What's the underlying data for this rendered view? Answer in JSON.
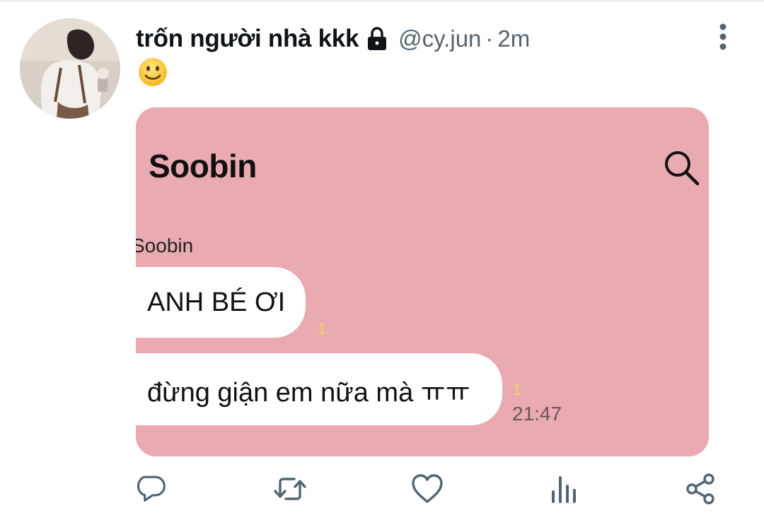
{
  "tweet": {
    "display_name": "trốn người nhà kkk",
    "handle": "@cy.jun",
    "separator": "·",
    "time": "2m",
    "emoji": "🙂"
  },
  "media": {
    "chat_title": "Soobin",
    "sender_name": "Soobin",
    "messages": [
      {
        "text": "ANH BÉ ƠI",
        "unread": "1"
      },
      {
        "text": "đừng giận em nữa mà ㅠㅠ",
        "unread": "1",
        "time": "21:47"
      }
    ],
    "background_color": "#eaaab1"
  },
  "icons": {
    "lock": "lock-icon",
    "more": "more-vertical-icon",
    "search": "search-icon",
    "reply": "reply-icon",
    "retweet": "retweet-icon",
    "like": "heart-icon",
    "views": "views-icon",
    "share": "share-icon"
  },
  "colors": {
    "text_primary": "#0f1419",
    "text_secondary": "#536471",
    "unread_badge": "#f3d25a"
  }
}
